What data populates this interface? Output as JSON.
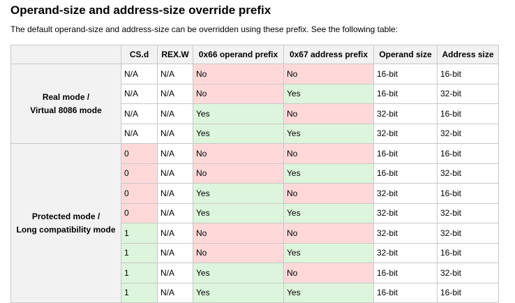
{
  "title": "Operand-size and address-size override prefix",
  "intro": "The default operand-size and address-size can be overridden using these prefix. See the following table:",
  "colors": {
    "no": "#ffd9d9",
    "yes": "#dcf5dc",
    "header": "#f2f2f2"
  },
  "table": {
    "headers": [
      "",
      "CS.d",
      "REX.W",
      "0x66 operand prefix",
      "0x67 address prefix",
      "Operand size",
      "Address size"
    ],
    "groups": [
      {
        "mode_line1": "Real mode /",
        "mode_line2": "Virtual 8086 mode",
        "rows": [
          [
            "N/A",
            "N/A",
            "No",
            "No",
            "16-bit",
            "16-bit"
          ],
          [
            "N/A",
            "N/A",
            "No",
            "Yes",
            "16-bit",
            "32-bit"
          ],
          [
            "N/A",
            "N/A",
            "Yes",
            "No",
            "32-bit",
            "16-bit"
          ],
          [
            "N/A",
            "N/A",
            "Yes",
            "Yes",
            "32-bit",
            "32-bit"
          ]
        ]
      },
      {
        "mode_line1": "Protected mode /",
        "mode_line2": "Long compatibility mode",
        "rows": [
          [
            "0",
            "N/A",
            "No",
            "No",
            "16-bit",
            "16-bit"
          ],
          [
            "0",
            "N/A",
            "No",
            "Yes",
            "16-bit",
            "32-bit"
          ],
          [
            "0",
            "N/A",
            "Yes",
            "No",
            "32-bit",
            "16-bit"
          ],
          [
            "0",
            "N/A",
            "Yes",
            "Yes",
            "32-bit",
            "32-bit"
          ],
          [
            "1",
            "N/A",
            "No",
            "No",
            "32-bit",
            "32-bit"
          ],
          [
            "1",
            "N/A",
            "No",
            "Yes",
            "32-bit",
            "16-bit"
          ],
          [
            "1",
            "N/A",
            "Yes",
            "No",
            "16-bit",
            "32-bit"
          ],
          [
            "1",
            "N/A",
            "Yes",
            "Yes",
            "16-bit",
            "16-bit"
          ]
        ]
      }
    ]
  }
}
